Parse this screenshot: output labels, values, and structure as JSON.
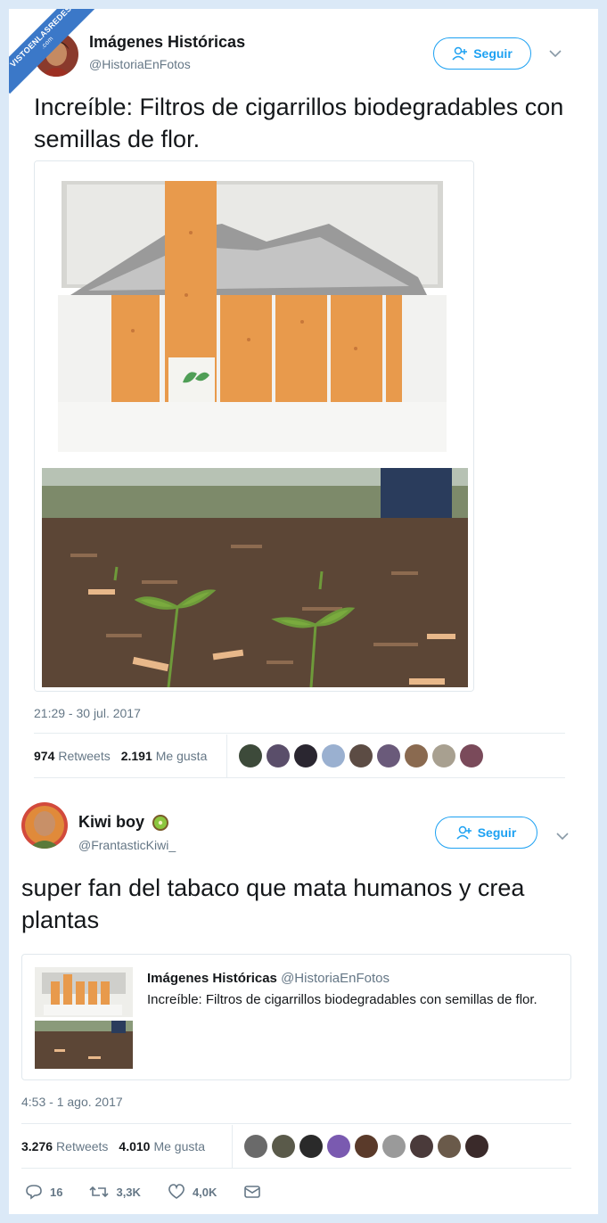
{
  "watermark": {
    "main": "VISTOENLASREDES",
    "sub": ".com"
  },
  "tweet1": {
    "name": "Imágenes Históricas",
    "handle": "@HistoriaEnFotos",
    "follow_label": "Seguir",
    "text": "Increíble: Filtros de cigarrillos biodegradables con semillas de flor.",
    "timestamp": "21:29 - 30 jul. 2017",
    "retweets_count": "974",
    "retweets_label": "Retweets",
    "likes_count": "2.191",
    "likes_label": "Me gusta"
  },
  "tweet2": {
    "name": "Kiwi boy",
    "handle": "@FrantasticKiwi_",
    "follow_label": "Seguir",
    "text": "super fan del tabaco que mata humanos y crea plantas",
    "quote": {
      "name": "Imágenes Históricas",
      "handle": "@HistoriaEnFotos",
      "text": "Increíble: Filtros de cigarrillos biodegradables con semillas de flor."
    },
    "timestamp": "4:53 - 1 ago. 2017",
    "retweets_count": "3.276",
    "retweets_label": "Retweets",
    "likes_count": "4.010",
    "likes_label": "Me gusta",
    "reply_count": "16",
    "retweet_action_count": "3,3K",
    "like_action_count": "4,0K"
  },
  "icons": {
    "follow": "person-add-icon",
    "dropdown": "chevron-down-icon",
    "reply": "reply-icon",
    "retweet": "retweet-icon",
    "like": "heart-icon",
    "message": "envelope-icon"
  },
  "colors": {
    "accent": "#1da1f2",
    "muted": "#657786",
    "border": "#e1e8ed"
  }
}
